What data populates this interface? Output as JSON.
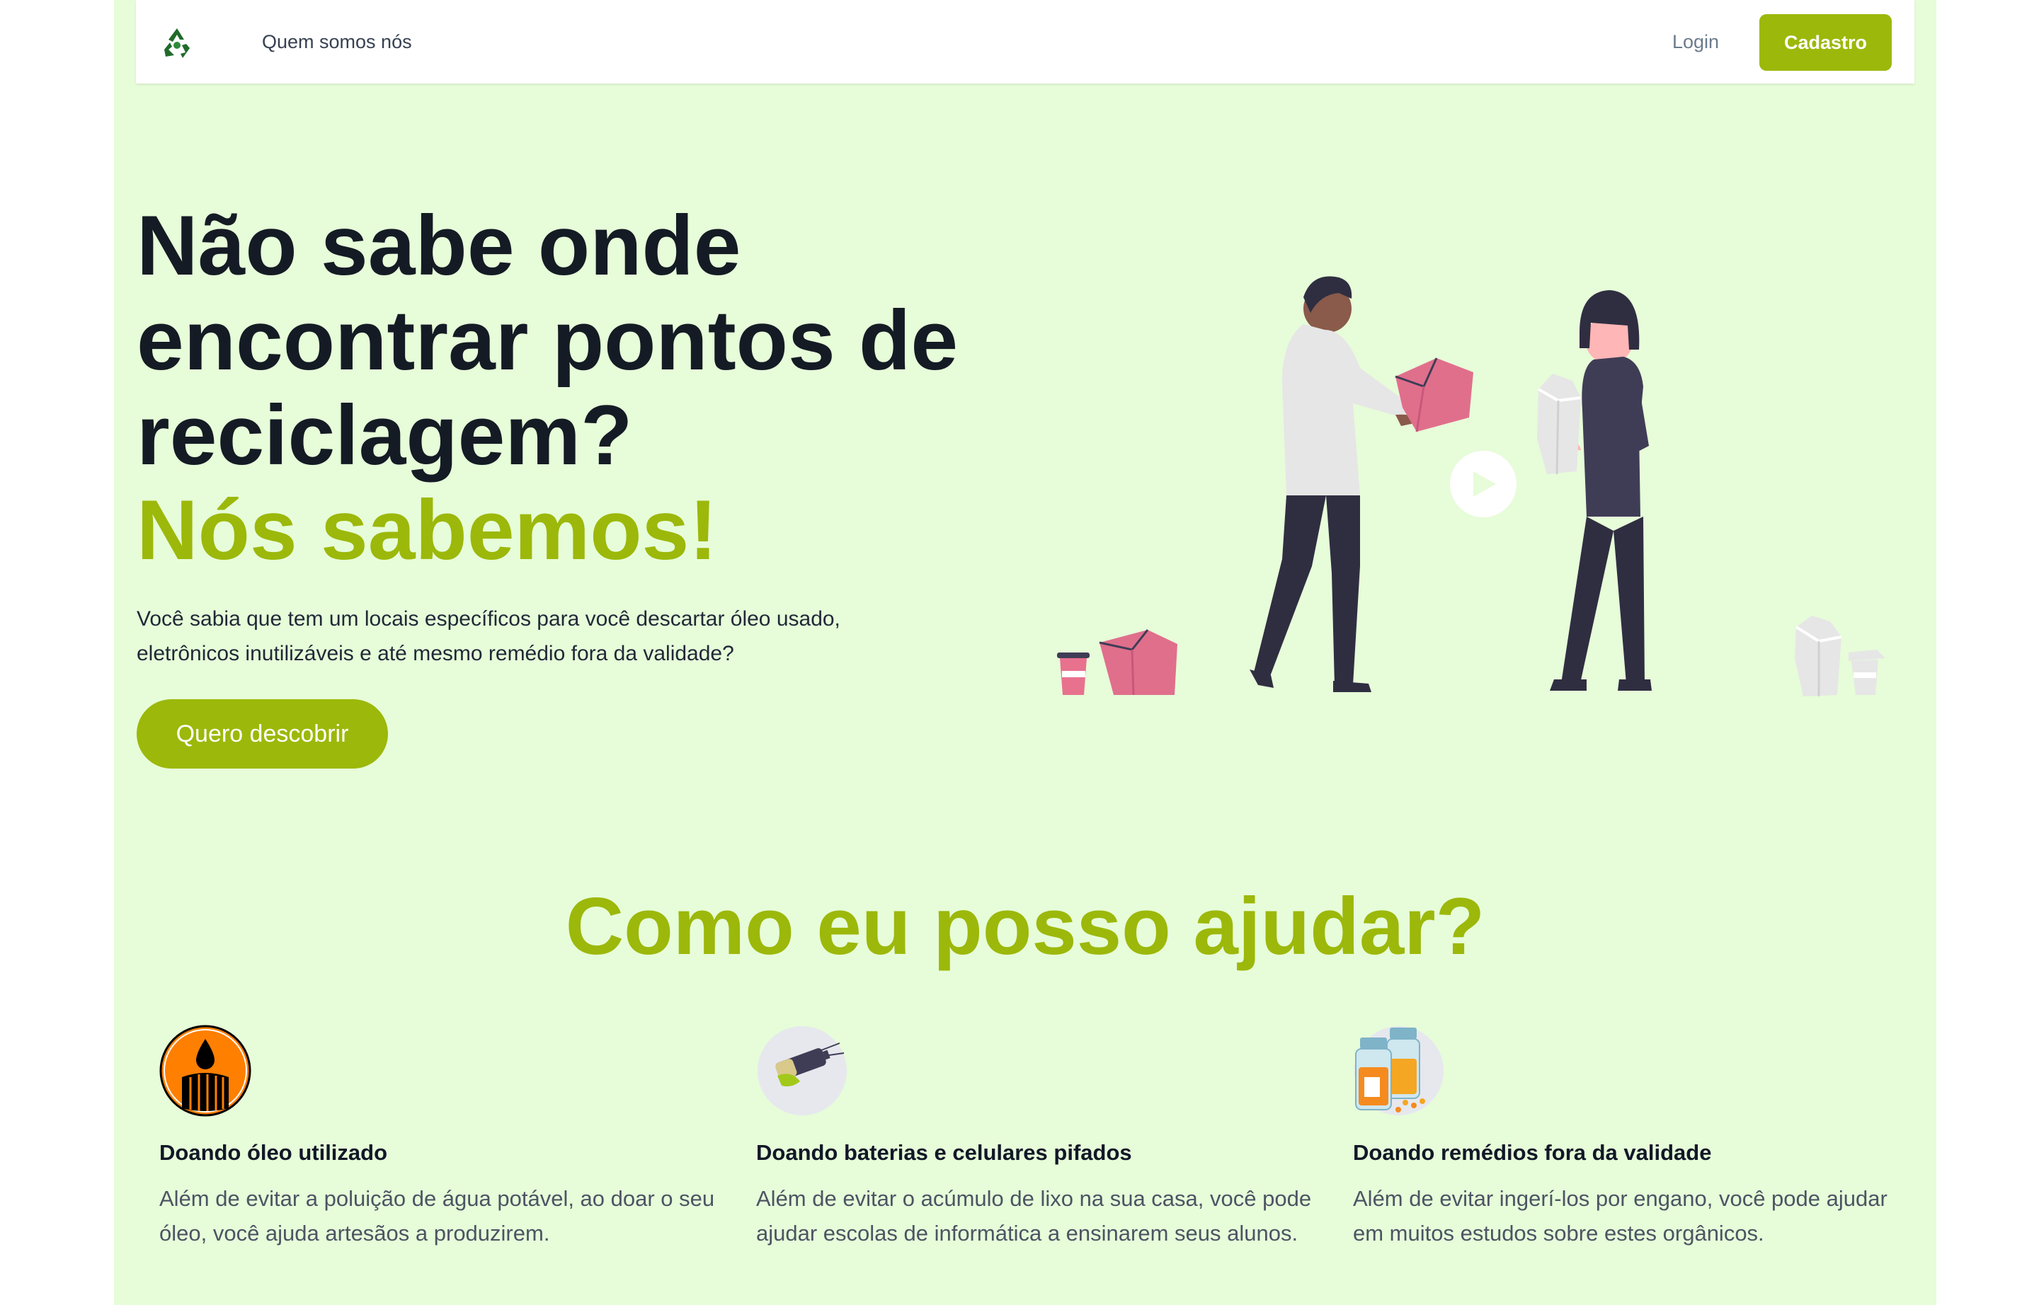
{
  "nav": {
    "about_label": "Quem somos nós",
    "login_label": "Login",
    "signup_label": "Cadastro"
  },
  "hero": {
    "title": "Não sabe onde encontrar pontos de reciclagem?",
    "accent": "Nós sabemos!",
    "description": "Você sabia que tem um locais específicos para você descartar óleo usado, eletrônicos inutilizáveis e até mesmo remédio fora da validade?",
    "cta_label": "Quero descobrir"
  },
  "help": {
    "title": "Como eu posso ajudar?",
    "cards": [
      {
        "title": "Doando óleo utilizado",
        "text": "Além de evitar a poluição de água potável, ao doar o seu óleo, você ajuda artesãos a produzirem.",
        "icon": "oil-barrel-icon"
      },
      {
        "title": "Doando baterias e celulares pifados",
        "text": "Além de evitar o acúmulo de lixo na sua casa, você pode ajudar escolas de informática a ensinarem seus alunos.",
        "icon": "battery-icon"
      },
      {
        "title": "Doando remédios fora da validade",
        "text": "Além de evitar ingerí-los por engano, você pode ajudar em muitos estudos sobre estes orgânicos.",
        "icon": "medicine-bottles-icon"
      }
    ]
  },
  "colors": {
    "accent": "#9cb80a",
    "background": "#e7fcd9",
    "heading": "#141b24"
  }
}
